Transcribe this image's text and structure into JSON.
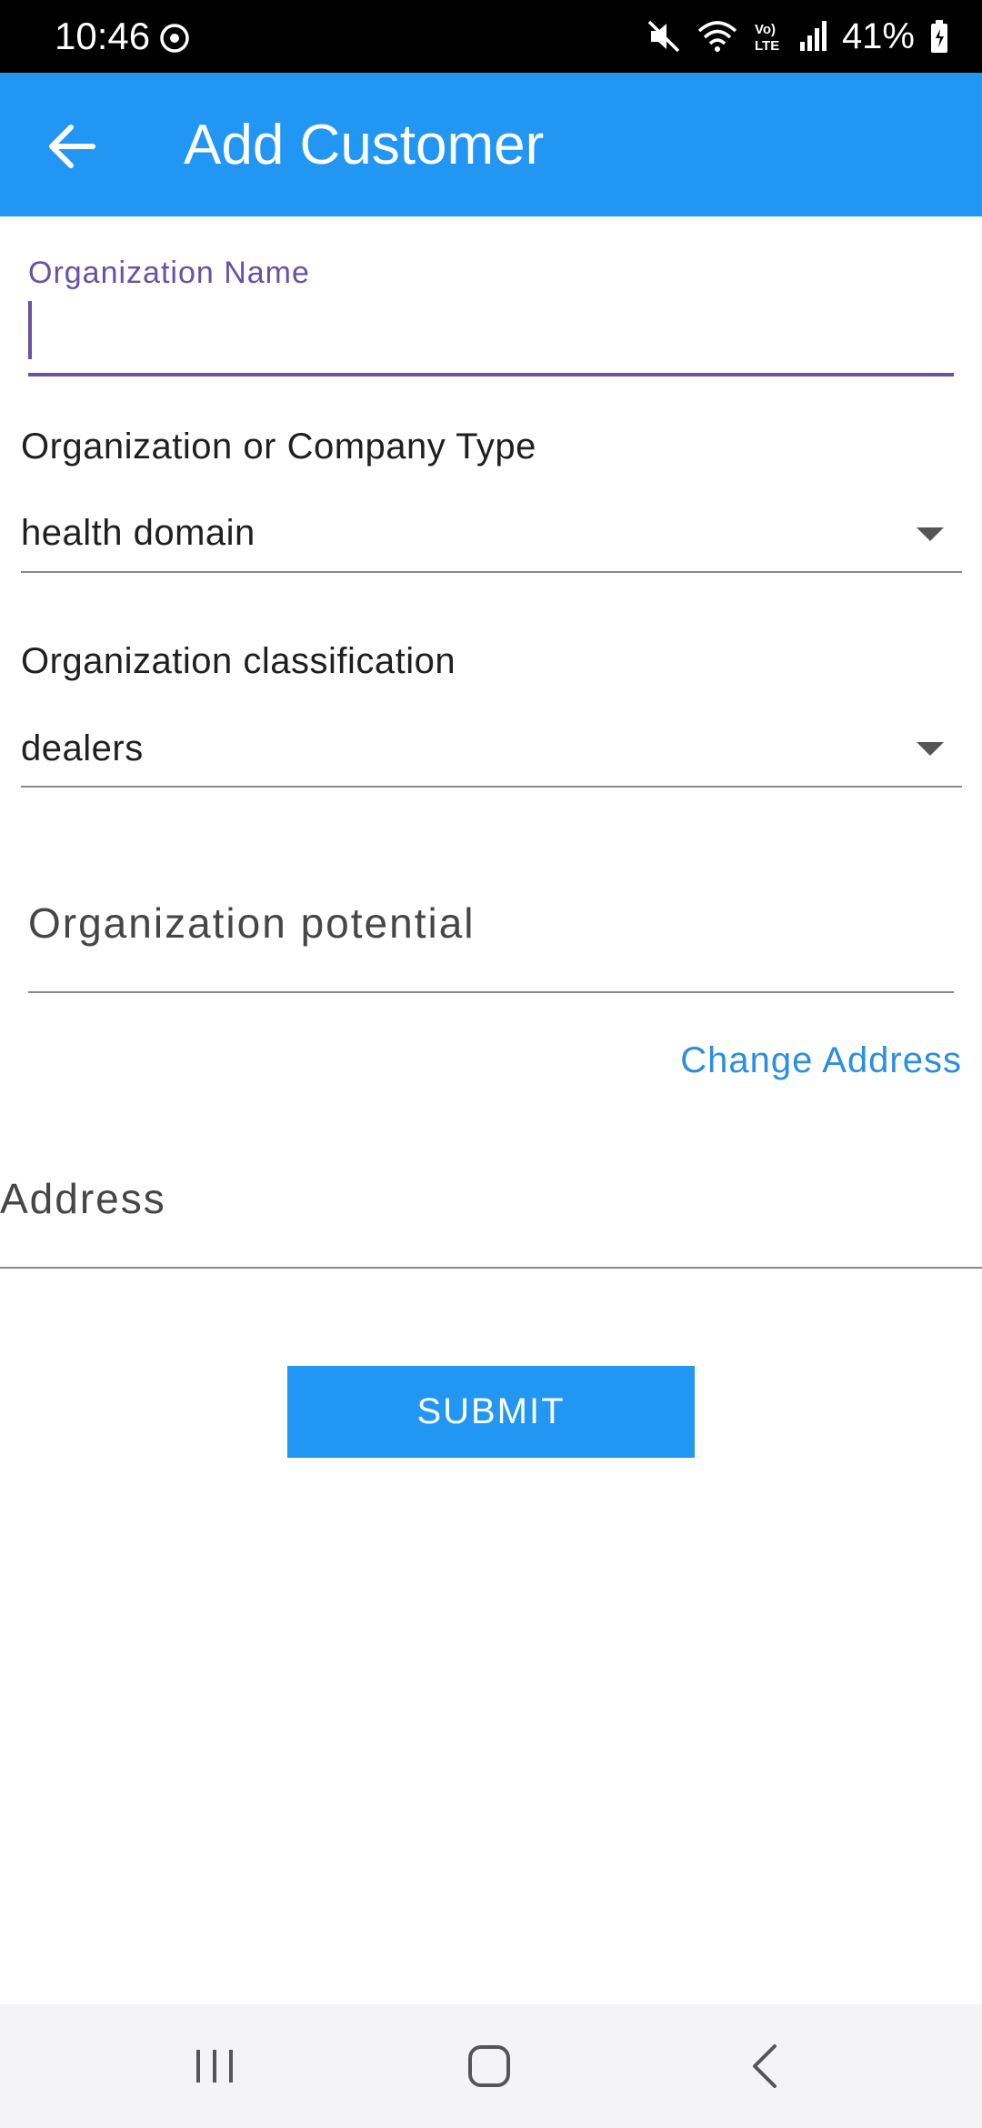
{
  "status_bar": {
    "time": "10:46",
    "battery": "41%",
    "icons": [
      "sync-icon",
      "mute-icon",
      "wifi-icon",
      "volte-icon",
      "signal-icon",
      "battery-icon"
    ]
  },
  "app_bar": {
    "title": "Add Customer",
    "back_icon": "arrow-left-icon",
    "color": "#2196f3"
  },
  "form": {
    "org_name": {
      "label": "Organization Name",
      "value": ""
    },
    "org_type": {
      "label": "Organization or Company Type",
      "selected": "health domain"
    },
    "org_classification": {
      "label": "Organization classification",
      "selected": "dealers"
    },
    "org_potential": {
      "placeholder": "Organization potential"
    },
    "change_address_link": "Change Address",
    "address": {
      "placeholder": "Address"
    },
    "submit_label": "SUBMIT"
  },
  "nav_bar": {
    "buttons": [
      "recent-apps-icon",
      "home-icon",
      "back-icon"
    ]
  }
}
